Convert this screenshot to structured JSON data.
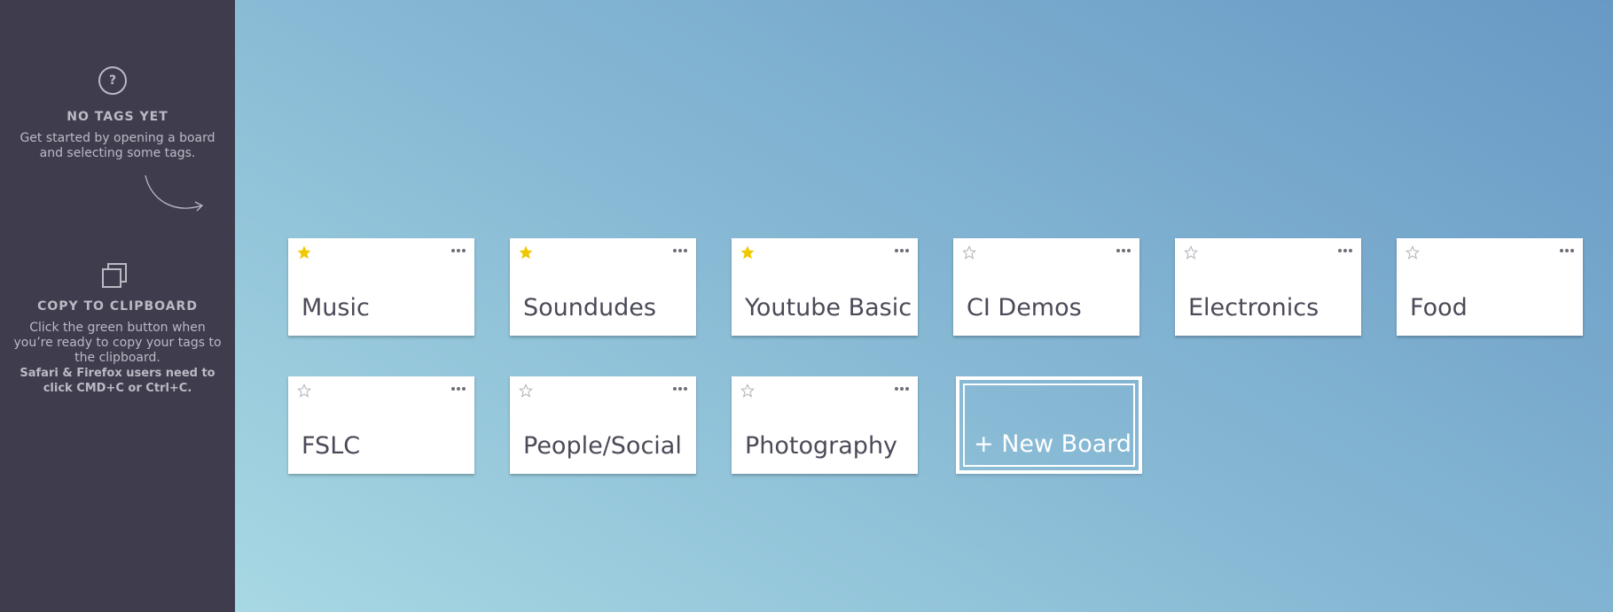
{
  "sidebar": {
    "tags": {
      "icon": "question-icon",
      "icon_glyph": "?",
      "title": "NO TAGS YET",
      "desc_line1": "Get started by opening a board",
      "desc_line2": "and selecting some tags."
    },
    "clipboard": {
      "icon": "copy-icon",
      "title": "COPY TO CLIPBOARD",
      "desc_line1": "Click the green button when",
      "desc_line2": "you’re ready to copy your tags to",
      "desc_line3": "the clipboard.",
      "bold_line1": "Safari & Firefox users need to",
      "bold_line2": "click CMD+C or Ctrl+C."
    }
  },
  "colors": {
    "sidebar_bg": "#3e3c4d",
    "star_active": "#f0c800",
    "star_inactive": "#b5b5bc",
    "card_text": "#4a4a58"
  },
  "boards": [
    {
      "name": "Music",
      "starred": true
    },
    {
      "name": "Soundudes",
      "starred": true
    },
    {
      "name": "Youtube Basic",
      "starred": true
    },
    {
      "name": "CI Demos",
      "starred": false
    },
    {
      "name": "Electronics",
      "starred": false
    },
    {
      "name": "Food",
      "starred": false
    },
    {
      "name": "FSLC",
      "starred": false
    },
    {
      "name": "People/Social",
      "starred": false
    },
    {
      "name": "Photography",
      "starred": false
    }
  ],
  "new_board_label": "+ New Board"
}
